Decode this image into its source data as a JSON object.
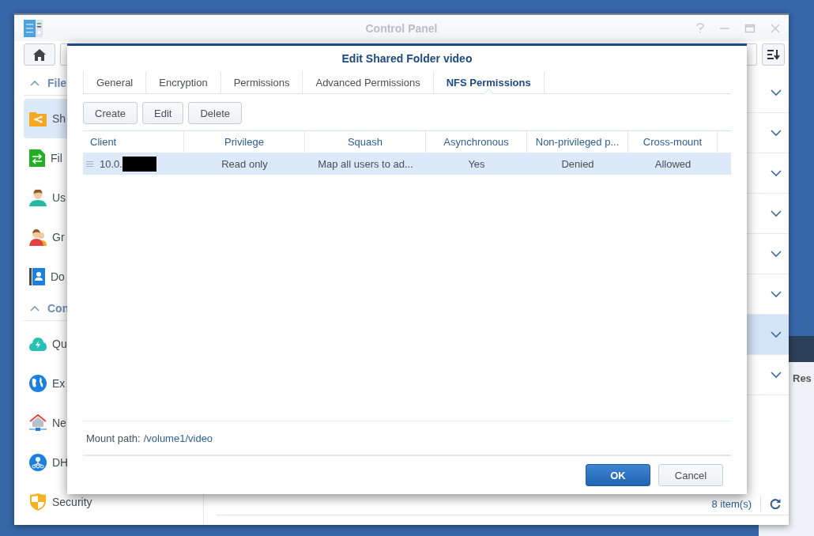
{
  "window": {
    "title": "Control Panel"
  },
  "sidebar": {
    "sections": [
      {
        "label": "File",
        "expanded": true,
        "items": [
          {
            "label": "Sh",
            "selected": true
          },
          {
            "label": "Fil",
            "selected": false
          },
          {
            "label": "Us",
            "selected": false
          },
          {
            "label": "Gr",
            "selected": false
          },
          {
            "label": "Do",
            "selected": false
          }
        ]
      },
      {
        "label": "Con",
        "expanded": true,
        "items": [
          {
            "label": "Qu",
            "selected": false
          },
          {
            "label": "Ex",
            "selected": false
          },
          {
            "label": "Ne",
            "selected": false
          },
          {
            "label": "DH",
            "selected": false
          },
          {
            "label": "Security",
            "selected": false
          }
        ]
      }
    ]
  },
  "content": {
    "rows": [
      {
        "selected": false
      },
      {
        "selected": false
      },
      {
        "selected": false
      },
      {
        "selected": false
      },
      {
        "selected": false
      },
      {
        "selected": false
      },
      {
        "selected": true
      },
      {
        "selected": false
      }
    ],
    "status": "8 item(s)"
  },
  "dialog": {
    "title": "Edit Shared Folder video",
    "tabs": [
      {
        "label": "General",
        "selected": false
      },
      {
        "label": "Encryption",
        "selected": false
      },
      {
        "label": "Permissions",
        "selected": false
      },
      {
        "label": "Advanced Permissions",
        "selected": false
      },
      {
        "label": "NFS Permissions",
        "selected": true
      }
    ],
    "buttons": [
      "Create",
      "Edit",
      "Delete"
    ],
    "table": {
      "columns": [
        "Client",
        "Privilege",
        "Squash",
        "Asynchronous",
        "Non-privileged p...",
        "Cross-mount"
      ],
      "rows": [
        {
          "selected": true,
          "cells": [
            "10.0.",
            "Read only",
            "Map all users to ad...",
            "Yes",
            "Denied",
            "Allowed"
          ]
        }
      ]
    },
    "mount_path": {
      "label": "Mount path:",
      "value": "/volume1/video"
    },
    "footer_buttons": [
      {
        "label": "OK",
        "kind": "primary"
      },
      {
        "label": "Cancel",
        "kind": "secondary"
      }
    ]
  },
  "background_window": {
    "label": "Res"
  }
}
